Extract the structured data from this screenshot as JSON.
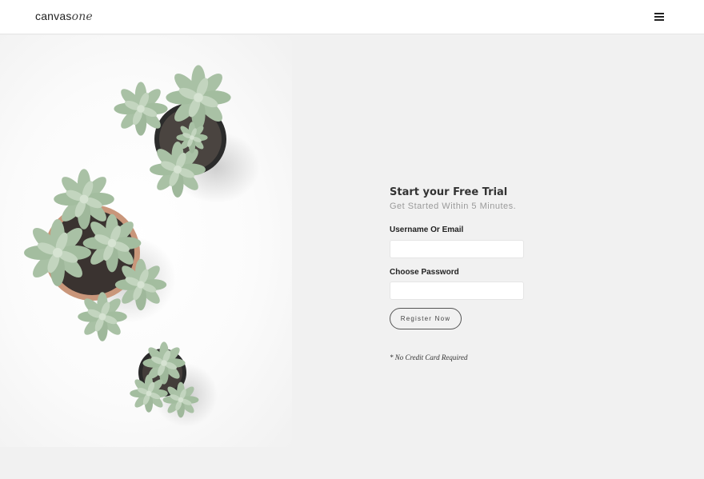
{
  "header": {
    "logo_main": "canvas",
    "logo_accent": "one",
    "menu_icon": "hamburger-menu-icon"
  },
  "hero": {
    "image": "potted-succulents-photo"
  },
  "signup": {
    "title": "Start your Free Trial",
    "subtitle": "Get Started Within 5 Minutes.",
    "username_label": "Username Or Email",
    "username_value": "",
    "password_label": "Choose Password",
    "password_value": "",
    "submit_label": "Register Now",
    "footnote": "* No Credit Card Required"
  }
}
